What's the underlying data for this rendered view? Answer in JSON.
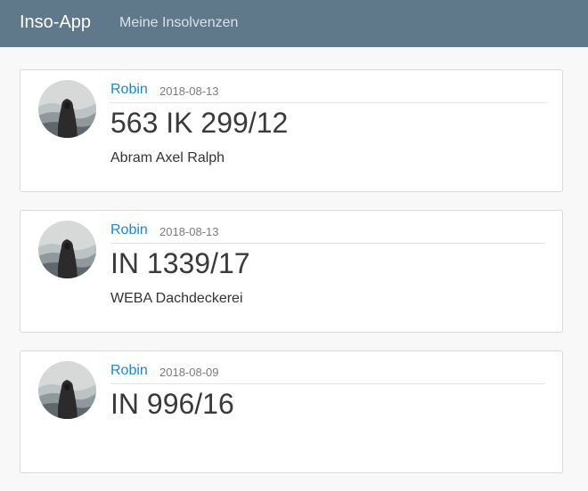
{
  "navbar": {
    "brand": "Inso-App",
    "link": "Meine Insolvenzen",
    "background": "#5f788a"
  },
  "accent_color": "#1a86d9",
  "avatar_icon": "hooded-figure-mountains-icon",
  "entries": [
    {
      "author": "Robin",
      "date": "2018-08-13",
      "case_number": "563 IK 299/12",
      "debtor": "Abram Axel Ralph"
    },
    {
      "author": "Robin",
      "date": "2018-08-13",
      "case_number": "IN 1339/17",
      "debtor": "WEBA Dachdeckerei"
    },
    {
      "author": "Robin",
      "date": "2018-08-09",
      "case_number": "IN 996/16",
      "debtor": ""
    }
  ]
}
